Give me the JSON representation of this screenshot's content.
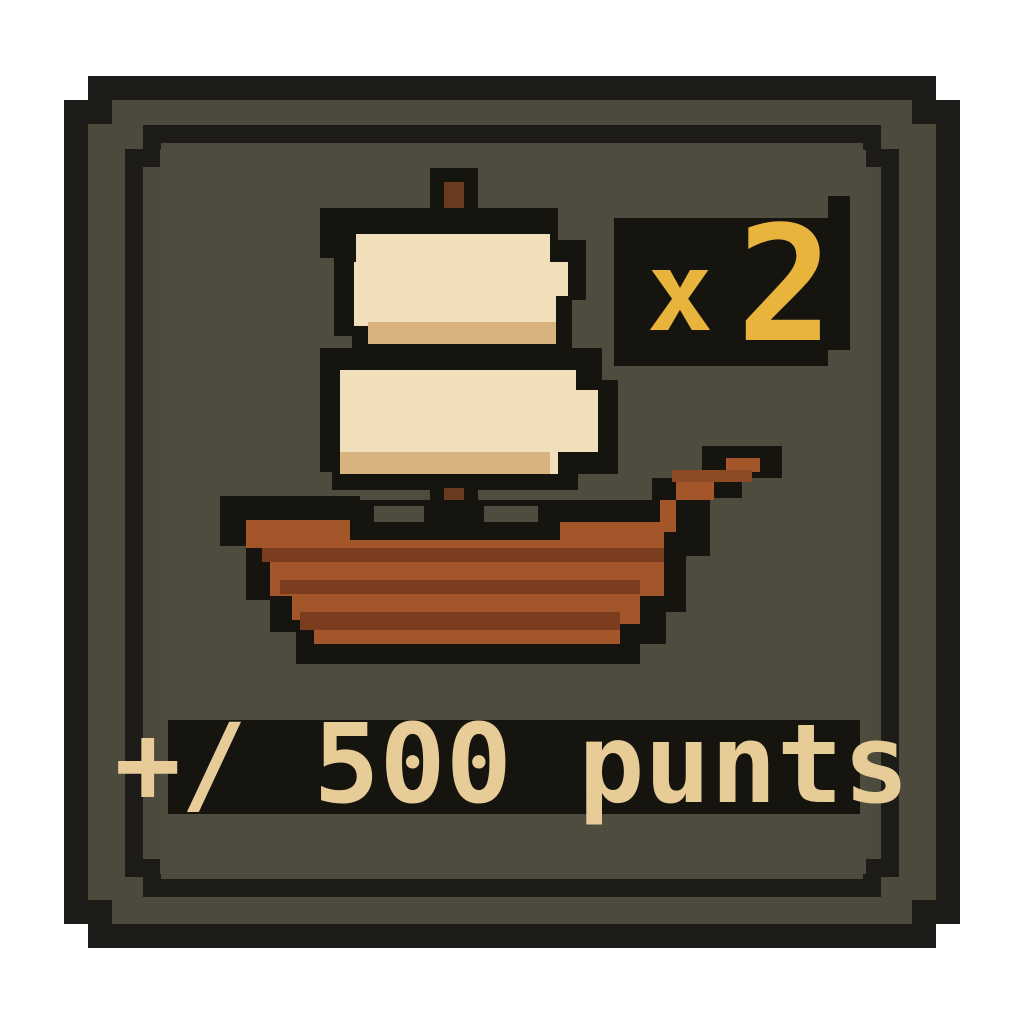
{
  "card": {
    "multiplier": {
      "prefix": "x",
      "value": "2"
    },
    "reward_text": "+/ 500 punts",
    "icon": "sailing-ship-icon"
  },
  "colors": {
    "panel_bg": "#4b4a3c",
    "panel_border": "#1d1c18",
    "panel_inner_line": "#3a392f",
    "gold": "#e8b43c",
    "cream_text": "#e7cc98",
    "sail_light": "#f1dfbc",
    "sail_shadow": "#d8b27f",
    "mast": "#6a3a21",
    "hull_light": "#a4562b",
    "hull_dark": "#7a3e1f",
    "outline": "#16140f"
  }
}
